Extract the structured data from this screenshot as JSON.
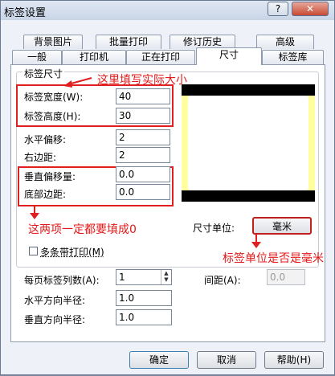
{
  "window": {
    "title": "标签设置",
    "help_label": "?",
    "close_label": "✕"
  },
  "tabs_row1": [
    "背景图片",
    "批量打印",
    "修订历史",
    "高级"
  ],
  "tabs_row2": [
    "一般",
    "打印机",
    "正在打印",
    "尺寸",
    "标签库"
  ],
  "active_tab": "尺寸",
  "size_group": {
    "legend": "标签尺寸",
    "width_label": "标签宽度(W):",
    "width_value": "40",
    "height_label": "标签高度(H):",
    "height_value": "30",
    "hgap_label": "水平偏移:",
    "hgap_value": "2",
    "right_margin_label": "右边距:",
    "right_margin_value": "2",
    "voffset_label": "垂直偏移量:",
    "voffset_value": "0.0",
    "bottom_margin_label": "底部边距:",
    "bottom_margin_value": "0.0"
  },
  "unit": {
    "label": "尺寸单位:",
    "value": "毫米"
  },
  "multi_strip": {
    "label": "多条带打印(M)",
    "checked": false
  },
  "columns": {
    "label": "每页标签列数(A):",
    "value": "1"
  },
  "spacing": {
    "label": "间距(A):",
    "value": "0.0"
  },
  "h_radius": {
    "label": "水平方向半径:",
    "value": "1.0"
  },
  "v_radius": {
    "label": "垂直方向半径:",
    "value": "1.0"
  },
  "annotations": {
    "fill_actual_size": "这里填写实际大小",
    "must_fill_zero": "这两项一定都要填成0",
    "unit_is_mm": "标签单位是否是毫米"
  },
  "footer": {
    "ok": "确定",
    "cancel": "取消",
    "help": "帮助(H)"
  },
  "colors": {
    "annotation_red": "#e02020",
    "preview_black": "#000000",
    "preview_yellow": "#ffffa0"
  }
}
